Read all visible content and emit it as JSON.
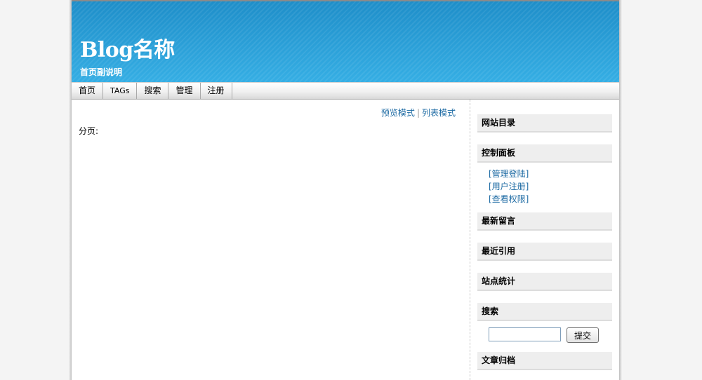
{
  "header": {
    "blog_title": "Blog名称",
    "subtitle": "首页副说明"
  },
  "nav": {
    "items": [
      {
        "label": "首页"
      },
      {
        "label": "TAGs"
      },
      {
        "label": "搜索"
      },
      {
        "label": "管理"
      },
      {
        "label": "注册"
      }
    ]
  },
  "content": {
    "view_modes": {
      "preview": "预览模式",
      "separator": "|",
      "list": "列表模式"
    },
    "pager_label": "分页:"
  },
  "sidebar": {
    "site_directory": "网站目录",
    "control_panel": {
      "title": "控制面板",
      "links": [
        "[管理登陆]",
        "[用户注册]",
        "[查看权限]"
      ]
    },
    "latest_comments": "最新留言",
    "recent_trackbacks": "最近引用",
    "site_stats": "站点统计",
    "search": {
      "title": "搜索",
      "input_value": "",
      "button_label": "提交"
    },
    "archives": "文章归档"
  },
  "colors": {
    "header_blue": "#2a9fd6",
    "link_blue": "#1c6aa3",
    "widget_bg": "#eeeeee"
  }
}
